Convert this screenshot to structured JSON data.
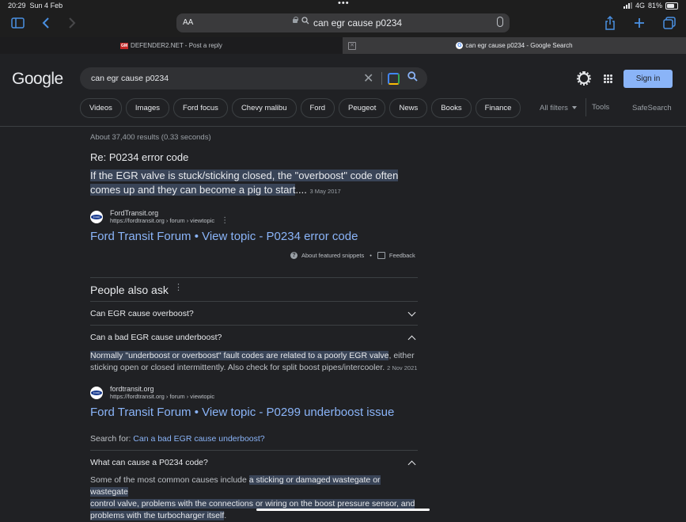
{
  "status": {
    "time": "20:29",
    "date": "Sun 4 Feb",
    "network": "4G",
    "battery": "81%"
  },
  "browser": {
    "reader_label": "AA",
    "url_text": "can egr cause p0234",
    "tabs": [
      {
        "favicon": "GM",
        "title": "DEFENDER2.NET - Post a reply"
      },
      {
        "favicon": "G",
        "title": "can egr cause p0234 - Google Search"
      }
    ]
  },
  "google": {
    "logo": "Google",
    "query": "can egr cause p0234",
    "sign_in": "Sign in",
    "chips": [
      "Videos",
      "Images",
      "Ford focus",
      "Chevy malibu",
      "Ford",
      "Peugeot",
      "News",
      "Books",
      "Finance"
    ],
    "all_filters": "All filters",
    "tools": "Tools",
    "safesearch": "SafeSearch"
  },
  "results": {
    "stats": "About 37,400 results (0.33 seconds)",
    "snippet": {
      "heading": "Re: P0234 error code",
      "text_highlight": "If the EGR valve is stuck/sticking closed, the \"overboost\" code often comes up and they can become a pig to start",
      "text_tail": "....",
      "date": "3 May 2017",
      "site_name": "FordTransit.org",
      "site_url": "https://fordtransit.org › forum › viewtopic",
      "title": "Ford Transit Forum • View topic - P0234 error code",
      "about": "About featured snippets",
      "feedback": "Feedback"
    },
    "paa": {
      "title": "People also ask",
      "q1": "Can EGR cause overboost?",
      "q2": "Can a bad EGR cause underboost?",
      "a2_highlight": "Normally \"underboost or overboost\" fault codes are related to a poorly EGR valve",
      "a2_rest": ", either sticking open or closed intermittently. Also check for split boost pipes/intercooler.",
      "a2_date": "2 Nov 2021",
      "a2_site_name": "fordtransit.org",
      "a2_site_url": "https://fordtransit.org › forum › viewtopic",
      "a2_title": "Ford Transit Forum • View topic - P0299 underboost issue",
      "search_for_label": "Search for:",
      "search_for_link": "Can a bad EGR cause underboost?",
      "q3": "What can cause a P0234 code?",
      "a3_lead": "Some of the most common causes include ",
      "a3_highlight_1": "a sticking or damaged wastegate or wastegate",
      "a3_highlight_2": "control valve, problems with the connections or wiring on the boost pressure sensor, and",
      "a3_highlight_3": "problems with the turbocharger itself",
      "a3_end": "."
    }
  }
}
